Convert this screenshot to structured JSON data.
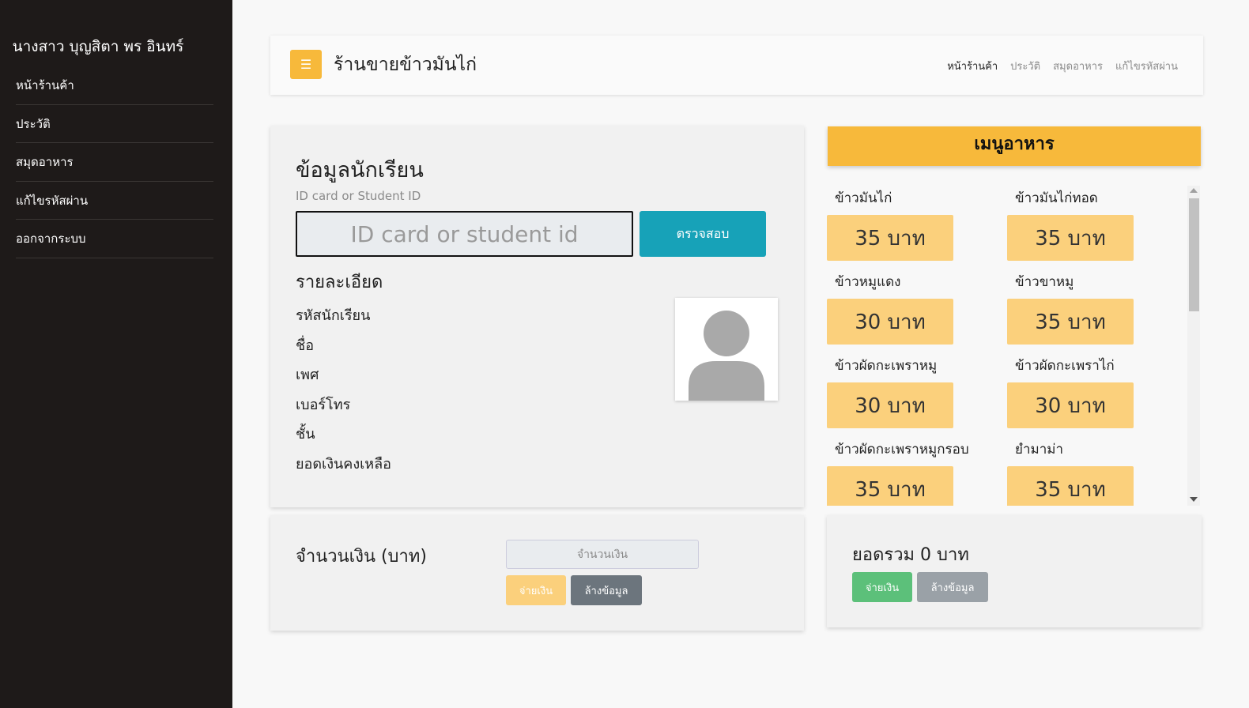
{
  "sidebar": {
    "user_name": "นางสาว บุญสิตา พร อินทร์",
    "items": [
      {
        "label": "หน้าร้านค้า"
      },
      {
        "label": "ประวัติ"
      },
      {
        "label": "สมุดอาหาร"
      },
      {
        "label": "แก้ไขรหัสผ่าน"
      },
      {
        "label": "ออกจากระบบ"
      }
    ]
  },
  "topbar": {
    "toggle_icon": "☰",
    "title": "ร้านขายข้าวมันไก่",
    "links": [
      {
        "label": "หน้าร้านค้า",
        "active": true
      },
      {
        "label": "ประวัติ",
        "active": false
      },
      {
        "label": "สมุดอาหาร",
        "active": false
      },
      {
        "label": "แก้ไขรหัสผ่าน",
        "active": false
      }
    ]
  },
  "student": {
    "title": "ข้อมูลนักเรียน",
    "id_label": "ID card or Student ID",
    "id_placeholder": "ID card or student id",
    "check_button": "ตรวจสอบ",
    "details_title": "รายละเอียด",
    "fields": [
      "รหัสนักเรียน",
      "ชื่อ",
      "เพศ",
      "เบอร์โทร",
      "ชั้น",
      "ยอดเงินคงเหลือ"
    ]
  },
  "payment": {
    "label": "จำนวนเงิน (บาท)",
    "amount_placeholder": "จำนวนเงิน",
    "pay_button": "จ่ายเงิน",
    "clear_button": "ล้างข้อมูล"
  },
  "menu": {
    "title": "เมนูอาหาร",
    "items": [
      {
        "name": "ข้าวมันไก่",
        "price": "35 บาท"
      },
      {
        "name": "ข้าวมันไก่ทอด",
        "price": "35 บาท"
      },
      {
        "name": "ข้าวหมูแดง",
        "price": "30 บาท"
      },
      {
        "name": "ข้าวขาหมู",
        "price": "35 บาท"
      },
      {
        "name": "ข้าวผัดกะเพราหมู",
        "price": "30 บาท"
      },
      {
        "name": "ข้าวผัดกะเพราไก่",
        "price": "30 บาท"
      },
      {
        "name": "ข้าวผัดกะเพราหมูกรอบ",
        "price": "35 บาท"
      },
      {
        "name": "ยำมาม่า",
        "price": "35 บาท"
      }
    ]
  },
  "total": {
    "text": "ยอดรวม 0 บาท",
    "pay_button": "จ่ายเงิน",
    "clear_button": "ล้างข้อมูล"
  }
}
